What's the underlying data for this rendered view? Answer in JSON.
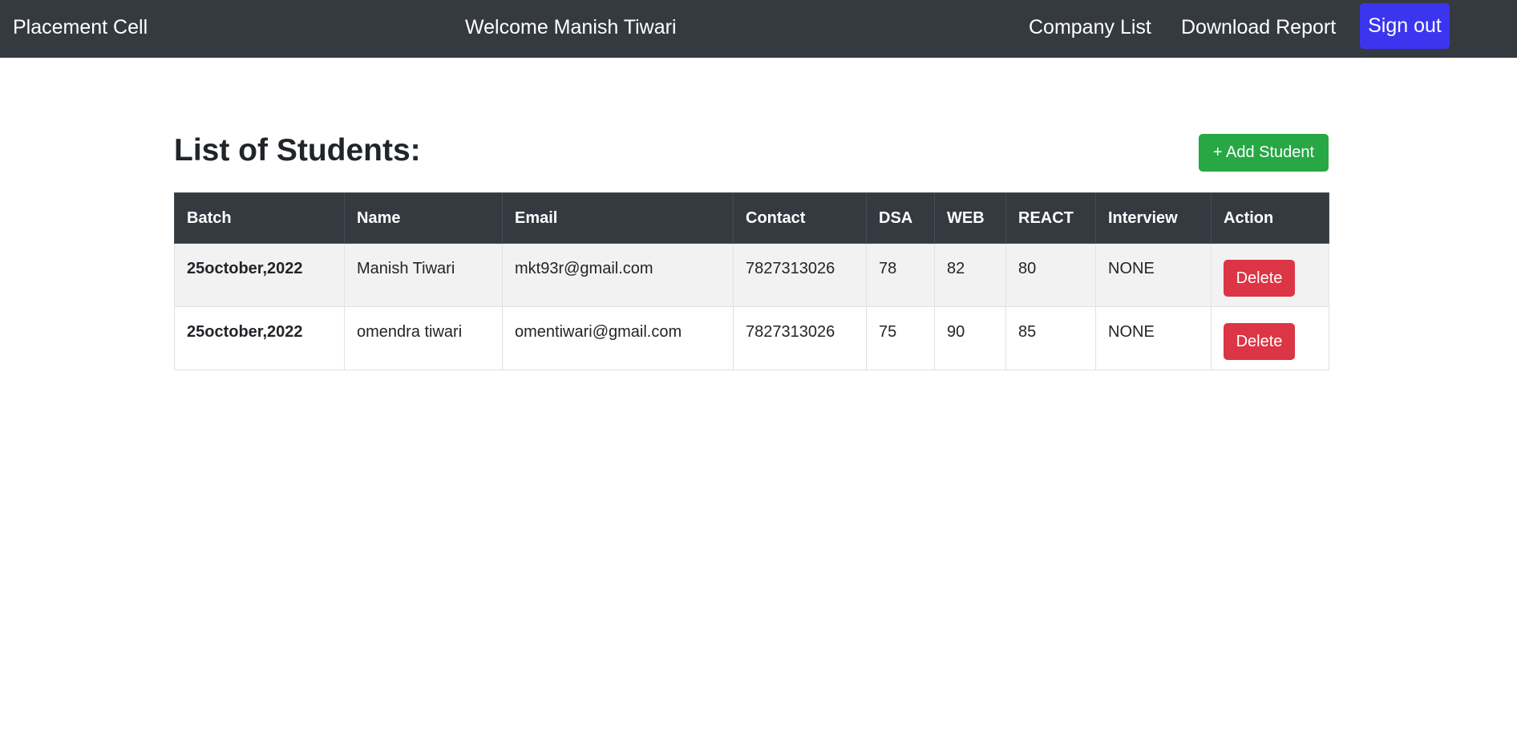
{
  "navbar": {
    "brand": "Placement Cell",
    "welcome": "Welcome Manish Tiwari",
    "company_list": "Company List",
    "download_report": "Download Report",
    "sign_out": "Sign out"
  },
  "main": {
    "title": "List of Students:",
    "add_button": "+ Add Student"
  },
  "table": {
    "headers": [
      "Batch",
      "Name",
      "Email",
      "Contact",
      "DSA",
      "WEB",
      "REACT",
      "Interview",
      "Action"
    ],
    "rows": [
      {
        "batch": "25october,2022",
        "name": "Manish Tiwari",
        "email": "mkt93r@gmail.com",
        "contact": "7827313026",
        "dsa": "78",
        "web": "82",
        "react": "80",
        "interview": "NONE",
        "action": "Delete"
      },
      {
        "batch": "25october,2022",
        "name": "omendra tiwari",
        "email": "omentiwari@gmail.com",
        "contact": "7827313026",
        "dsa": "75",
        "web": "90",
        "react": "85",
        "interview": "NONE",
        "action": "Delete"
      }
    ]
  },
  "colors": {
    "navbar_bg": "#343a40",
    "sign_out_bg": "#3b35f0",
    "add_button_bg": "#28a745",
    "delete_button_bg": "#dc3545"
  }
}
